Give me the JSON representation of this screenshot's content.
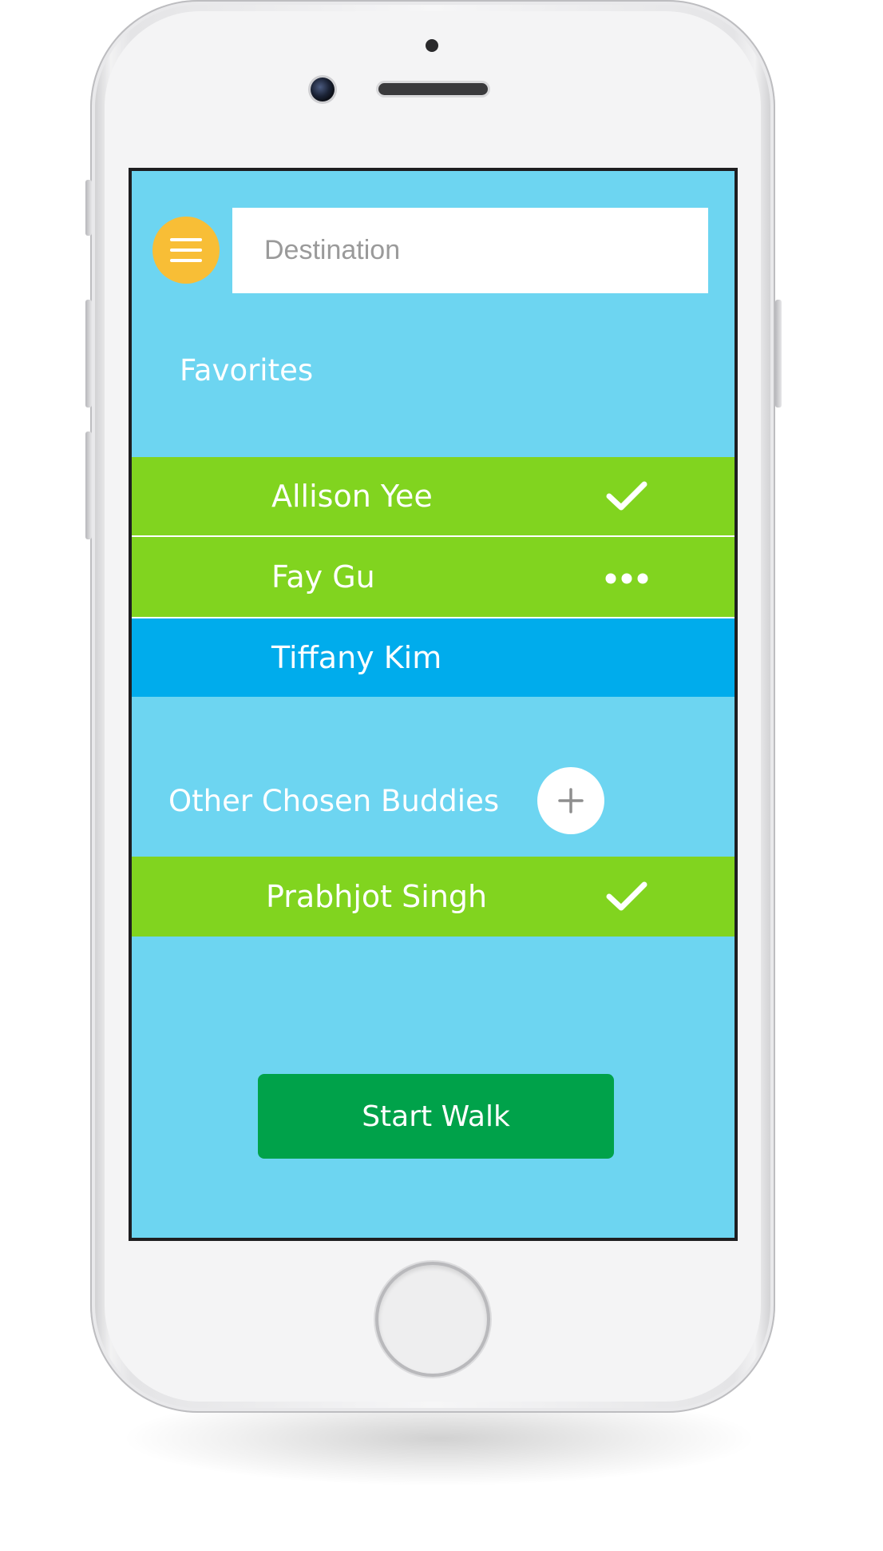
{
  "search": {
    "placeholder": "Destination"
  },
  "favorites": {
    "title": "Favorites",
    "items": [
      {
        "name": "Allison Yee",
        "status_icon": "check-icon"
      },
      {
        "name": "Fay Gu",
        "status_icon": "more-dots-icon"
      },
      {
        "name": "Tiffany Kim",
        "status_icon": ""
      }
    ]
  },
  "other_buddies": {
    "title": "Other Chosen Buddies",
    "add_icon": "plus-icon",
    "items": [
      {
        "name": "Prabhjot Singh",
        "status_icon": "check-icon"
      }
    ]
  },
  "actions": {
    "start_label": "Start Walk"
  },
  "menu": {
    "icon": "hamburger-menu-icon"
  },
  "colors": {
    "screen_background": "#6dd5f1",
    "menu_button": "#f8be36",
    "row_confirmed": "#81d41f",
    "row_selected": "#00acec",
    "start_button": "#00a24a"
  }
}
